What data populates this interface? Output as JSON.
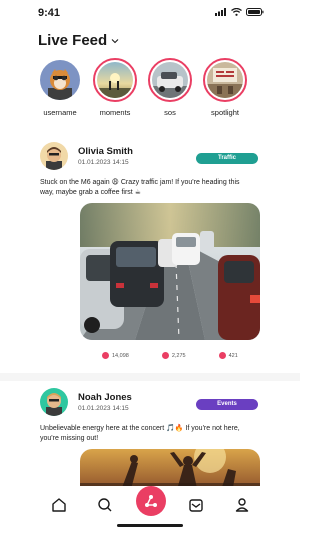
{
  "status": {
    "time": "9:41"
  },
  "header": {
    "title": "Live Feed"
  },
  "stories": [
    {
      "label": "username"
    },
    {
      "label": "moments"
    },
    {
      "label": "sos"
    },
    {
      "label": "spotlight"
    }
  ],
  "posts": [
    {
      "author": "Olivia Smith",
      "date": "01.01.2023 14:15",
      "tag": "Traffic",
      "tag_color": "#1f9f92",
      "text": "Stuck on the M6 again 😩 Crazy traffic jam! If you're heading this way, maybe grab a coffee first ☕",
      "metrics": {
        "likes": "14,098",
        "comments": "2,275",
        "shares": "421"
      }
    },
    {
      "author": "Noah Jones",
      "date": "01.01.2023 14:15",
      "tag": "Events",
      "tag_color": "#6a3fc1",
      "text": "Unbelievable energy here at the concert 🎵🔥 If you're not here, you're missing out!"
    }
  ],
  "colors": {
    "accent": "#ea3e63"
  }
}
